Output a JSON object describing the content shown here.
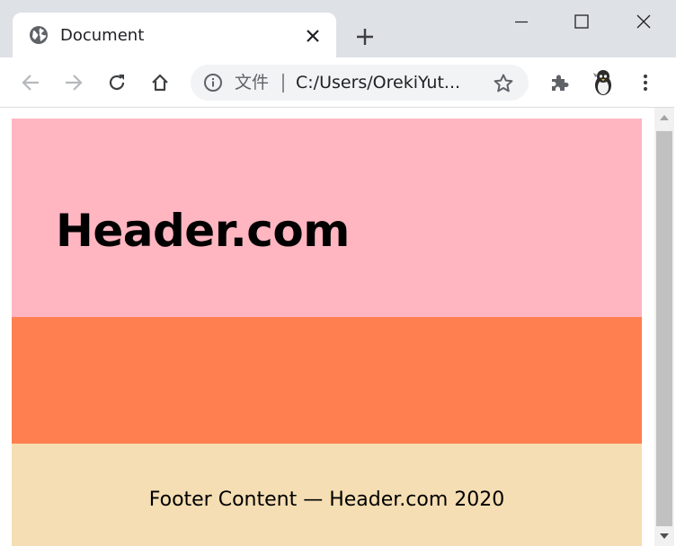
{
  "browser": {
    "tab": {
      "title": "Document",
      "icon": "globe-icon"
    },
    "new_tab_icon": "plus-icon",
    "window_controls": [
      "minimize-icon",
      "maximize-icon",
      "close-icon"
    ],
    "toolbar": {
      "back_icon": "back-arrow-icon",
      "forward_icon": "forward-arrow-icon",
      "reload_icon": "reload-icon",
      "home_icon": "home-icon",
      "address_label": "文件",
      "address_url": "C:/Users/OrekiYut...",
      "bookmark_icon": "star-icon",
      "extensions_icon": "puzzle-icon",
      "menu_icon": "more-vert-icon"
    }
  },
  "page": {
    "header": {
      "title": "Header.com",
      "bg": "#ffb6c1"
    },
    "middle": {
      "bg": "#ff7f50"
    },
    "footer": {
      "text": "Footer Content — Header.com 2020",
      "bg": "#f5deb3"
    }
  },
  "colors": {
    "chrome_frame": "#dee1e6",
    "omnibox": "#f1f3f4",
    "icon": "#5f6368",
    "icon_disabled": "#b5b8bc",
    "scroll_thumb": "#c1c1c1"
  }
}
